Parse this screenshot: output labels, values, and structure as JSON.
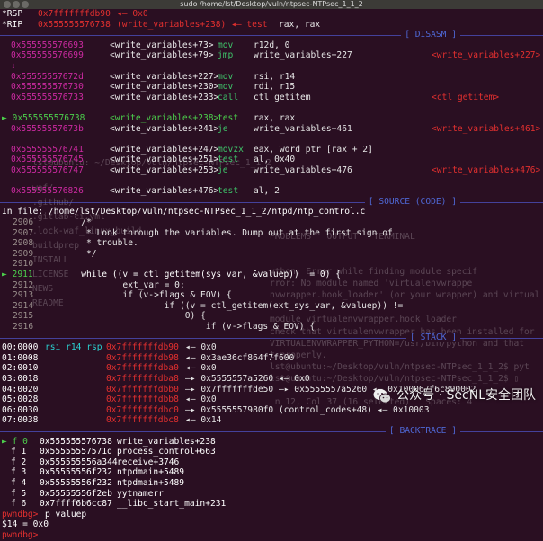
{
  "window": {
    "title": "sudo /home/lst/Desktop/vuln/ntpsec-NTPsec_1_1_2"
  },
  "registers": [
    {
      "label": "*RSP",
      "value": "0x7fffffffdb90",
      "arrow": "◂— 0x0",
      "extra": ""
    },
    {
      "label": "*RIP",
      "value": "0x555555576738",
      "arrow": "(write_variables+238) ◂— test",
      "extra": "rax, rax"
    }
  ],
  "disasm": {
    "header": "[ DISASM ]",
    "rows": [
      {
        "addr": "0x555555576693",
        "func": "<write_variables+73>",
        "mn": "mov",
        "ops": "r12d, 0",
        "note": ""
      },
      {
        "addr": "0x555555576699",
        "func": "<write_variables+79>",
        "mn": "jmp",
        "ops": "write_variables+227",
        "note": "<write_variables+227>"
      },
      {
        "addr": "↓",
        "func": "",
        "mn": "",
        "ops": "",
        "note": ""
      },
      {
        "addr": "0x55555557672d",
        "func": "<write_variables+227>",
        "mn": "mov",
        "ops": "rsi, r14",
        "note": ""
      },
      {
        "addr": "0x555555576730",
        "func": "<write_variables+230>",
        "mn": "mov",
        "ops": "rdi, r15",
        "note": ""
      },
      {
        "addr": "0x555555576733",
        "func": "<write_variables+233>",
        "mn": "call",
        "ops": "ctl_getitem",
        "note": "<ctl_getitem>"
      },
      {
        "addr": "",
        "func": "",
        "mn": "",
        "ops": "",
        "note": ""
      },
      {
        "addr": "► 0x555555576738",
        "func": "<write_variables+238>",
        "mn": "test",
        "ops": "rax, rax",
        "note": ""
      },
      {
        "addr": "0x55555557673b",
        "func": "<write_variables+241>",
        "mn": "je",
        "ops": "write_variables+461",
        "note": "<write_variables+461>"
      },
      {
        "addr": "",
        "func": "",
        "mn": "",
        "ops": "",
        "note": ""
      },
      {
        "addr": "0x555555576741",
        "func": "<write_variables+247>",
        "mn": "movzx",
        "ops": "eax, word ptr [rax + 2]",
        "note": ""
      },
      {
        "addr": "0x555555576745",
        "func": "<write_variables+251>",
        "mn": "test",
        "ops": "al, 0x40",
        "note": ""
      },
      {
        "addr": "0x555555576747",
        "func": "<write_variables+253>",
        "mn": "je",
        "ops": "write_variables+476",
        "note": "<write_variables+476>"
      },
      {
        "addr": "",
        "func": "",
        "mn": "",
        "ops": "",
        "note": ""
      },
      {
        "addr": "0x555555576826",
        "func": "<write_variables+476>",
        "mn": "test",
        "ops": "al, 2",
        "note": ""
      }
    ]
  },
  "source": {
    "header": "[ SOURCE (CODE) ]",
    "file_label": "In file: /home/lst/Desktop/vuln/ntpsec-NTPsec_1_1_2/ntpd/ntp_control.c",
    "lines": [
      {
        "no": "2906",
        "text": "        /*"
      },
      {
        "no": "2907",
        "text": "         * Look through the variables. Dump out at the first sign of"
      },
      {
        "no": "2908",
        "text": "         * trouble."
      },
      {
        "no": "2909",
        "text": "         */"
      },
      {
        "no": "2910",
        "text": ""
      },
      {
        "no": "► 2911",
        "text": "        while ((v = ctl_getitem(sys_var, &valuep)) != 0) {"
      },
      {
        "no": "2912",
        "text": "                ext_var = 0;"
      },
      {
        "no": "2913",
        "text": "                if (v->flags & EOV) {"
      },
      {
        "no": "2914",
        "text": "                        if ((v = ctl_getitem(ext_sys_var, &valuep)) !="
      },
      {
        "no": "2915",
        "text": "                            0) {"
      },
      {
        "no": "2916",
        "text": "                                if (v->flags & EOV) {"
      }
    ]
  },
  "stack": {
    "header": "[ STACK ]",
    "rows": [
      {
        "idx": "00:0000",
        "reg": "rsi r14 rsp",
        "addr": "0x7fffffffdb90",
        "val": "◂— 0x0"
      },
      {
        "idx": "01:0008",
        "reg": "",
        "addr": "0x7fffffffdb98",
        "val": "◂— 0x3ae36cf864f7f600"
      },
      {
        "idx": "02:0010",
        "reg": "",
        "addr": "0x7fffffffdba0",
        "val": "◂— 0x0"
      },
      {
        "idx": "03:0018",
        "reg": "",
        "addr": "0x7fffffffdba8",
        "val": "—▸ 0x5555557a5260 ◂— 0x0"
      },
      {
        "idx": "04:0020",
        "reg": "",
        "addr": "0x7fffffffdbb0",
        "val": "—▸ 0x7fffffffde50 —▸ 0x5555557a5260 ◂— 0x100067f6c890002"
      },
      {
        "idx": "05:0028",
        "reg": "",
        "addr": "0x7fffffffdbb8",
        "val": "◂— 0x0"
      },
      {
        "idx": "06:0030",
        "reg": "",
        "addr": "0x7fffffffdbc0",
        "val": "—▸ 0x5555557980f0 (control_codes+48) ◂— 0x10003"
      },
      {
        "idx": "07:0038",
        "reg": "",
        "addr": "0x7fffffffdbc8",
        "val": "◂— 0x14"
      }
    ]
  },
  "backtrace": {
    "header": "[ BACKTRACE ]",
    "rows": [
      {
        "frame": "► f 0",
        "addr": "0x555555576738",
        "sym": "write_variables+238"
      },
      {
        "frame": "f 1",
        "addr": "0x55555557571d",
        "sym": "process_control+663"
      },
      {
        "frame": "f 2",
        "addr": "0x555555556a344",
        "sym": "receive+3746"
      },
      {
        "frame": "f 3",
        "addr": "0x55555556f232",
        "sym": "ntpdmain+5489"
      },
      {
        "frame": "f 4",
        "addr": "0x55555556f232",
        "sym": "ntpdmain+5489"
      },
      {
        "frame": "f 5",
        "addr": "0x55555556f2eb",
        "sym": "yytnamerr"
      },
      {
        "frame": "f 6",
        "addr": "0x7ffff6b6cc87",
        "sym": "__libc_start_main+231"
      }
    ]
  },
  "console": [
    {
      "prompt": "pwndbg>",
      "cmd": "p valuep"
    },
    {
      "prompt": "",
      "cmd": "$14 = 0x0"
    },
    {
      "prompt": "pwndbg>",
      "cmd": ""
    }
  ],
  "ghost_overlay": {
    "lines_left": [
      "lst@ubuntu: ~/Desktop/vuln/ntpsec-NTPsec_1_1_2",
      "waf/",
      ".github/",
      ".gitlab-ci.yml",
      ".lock-waf_linux_build",
      "buildprep",
      "INSTALL",
      "LICENSE",
      "NEWS",
      "README"
    ],
    "lines_right": [
      "PROBLEMS   OUTPUT   TERMINAL",
      "ython: Error while finding module specif",
      "rror: No module named 'virtualenvwrappe",
      "nvwrapper.hook_loader' (or your wrapper) and virtualenv running",
      "module virtualenvwrapper.hook_loader",
      "check that virtualenvwrapper has been installed for",
      "VIRTUALENVWRAPPER_PYTHON=/usr/bin/python and that",
      "t properly.",
      "lst@ubuntu:~/Desktop/vuln/ntpsec-NTPsec_1_1_2$ pyt",
      "lst@ubuntu:~/Desktop/vuln/ntpsec-NTPsec_1_1_2$ ▯",
      "Ln 12, Col 37 (16 selected)   Spaces: 4"
    ]
  },
  "watermark": {
    "text": "公众号 · SecNL安全团队",
    "icon": "wechat-icon"
  },
  "colors": {
    "background": "#2a0f22",
    "address": "#cc2aa1",
    "mnemonic": "#3ec46a",
    "highlight": "#e3302f",
    "header": "#4f68d6"
  }
}
